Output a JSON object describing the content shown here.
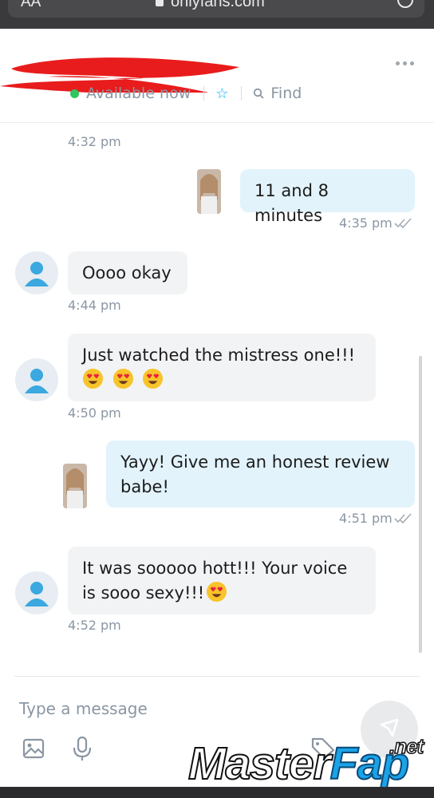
{
  "browser": {
    "aa_label": "AA",
    "url": "onlyfans.com"
  },
  "header": {
    "status": "Available now",
    "find_label": "Find"
  },
  "messages": [
    {
      "direction": "in",
      "text": "",
      "time": "4:32 pm"
    },
    {
      "direction": "out",
      "text": "11 and 8 minutes",
      "time": "4:35 pm"
    },
    {
      "direction": "in",
      "text": "Oooo okay",
      "time": "4:44 pm"
    },
    {
      "direction": "in",
      "text": "Just watched the mistress one!!!",
      "emoji_count": 3,
      "time": "4:50 pm"
    },
    {
      "direction": "out",
      "text_line1": "Yayy! Give me an honest review",
      "text_line2": "babe!",
      "time": "4:51 pm"
    },
    {
      "direction": "in",
      "text_line1": "It was sooooo hott!!! Your voice",
      "text_line2": "is sooo sexy!!!",
      "emoji_count": 1,
      "time": "4:52 pm"
    }
  ],
  "composer": {
    "placeholder": "Type a message"
  },
  "watermark": {
    "part1": "Master",
    "part2": "Fap",
    "suffix": ".net"
  },
  "colors": {
    "accent": "#00aff0",
    "online": "#30c55f",
    "incoming_bubble": "#f2f3f5",
    "outgoing_bubble": "#e2f3fb",
    "timestamp": "#8a96a3"
  },
  "icons": {
    "more": "more-horizontal-icon",
    "star": "star-icon",
    "search": "search-icon",
    "read": "double-check-icon",
    "image": "image-icon",
    "mic": "microphone-icon",
    "price": "price-tag-icon",
    "send": "send-icon"
  }
}
